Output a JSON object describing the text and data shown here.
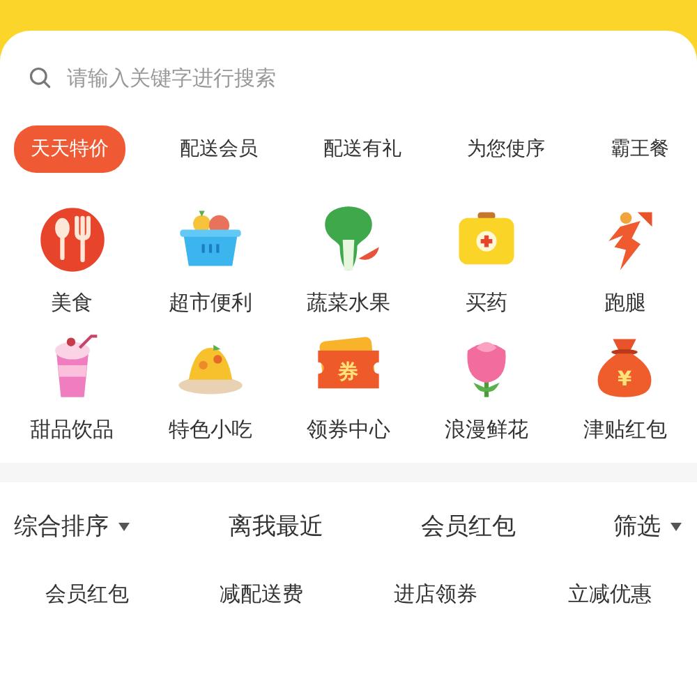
{
  "search": {
    "placeholder": "请输入关键字进行搜索"
  },
  "tabs": [
    {
      "label": "天天特价",
      "selected": true
    },
    {
      "label": "配送会员",
      "selected": false
    },
    {
      "label": "配送有礼",
      "selected": false
    },
    {
      "label": "为您使序",
      "selected": false
    },
    {
      "label": "霸王餐",
      "selected": false
    }
  ],
  "categories": [
    {
      "label": "美食",
      "kind": "food"
    },
    {
      "label": "超市便利",
      "kind": "basket"
    },
    {
      "label": "蔬菜水果",
      "kind": "vegetable"
    },
    {
      "label": "买药",
      "kind": "medicine"
    },
    {
      "label": "跑腿",
      "kind": "runner"
    },
    {
      "label": "甜品饮品",
      "kind": "drink"
    },
    {
      "label": "特色小吃",
      "kind": "snack"
    },
    {
      "label": "领券中心",
      "kind": "coupon",
      "glyph": "券"
    },
    {
      "label": "浪漫鲜花",
      "kind": "flower"
    },
    {
      "label": "津贴红包",
      "kind": "moneybag",
      "glyph": "¥"
    }
  ],
  "sort_bar": [
    {
      "label": "综合排序",
      "dropdown": true
    },
    {
      "label": "离我最近",
      "dropdown": false
    },
    {
      "label": "会员红包",
      "dropdown": false
    },
    {
      "label": "筛选",
      "dropdown": true
    }
  ],
  "filters": [
    "会员红包",
    "减配送费",
    "进店领券",
    "立减优惠"
  ]
}
